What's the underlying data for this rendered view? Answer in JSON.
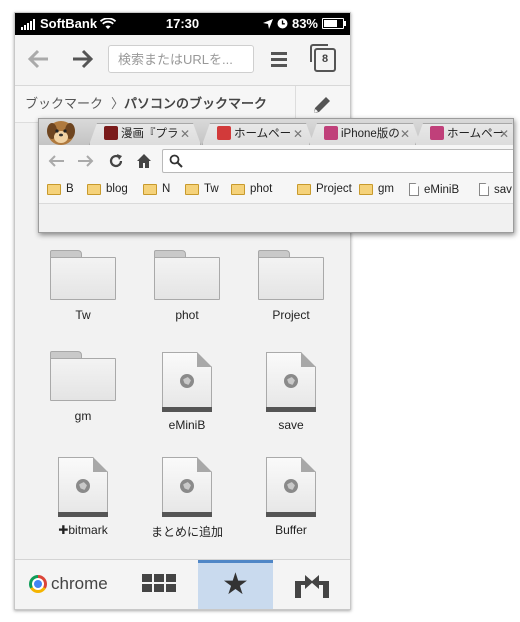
{
  "status_bar": {
    "carrier": "SoftBank",
    "time": "17:30",
    "battery": "83%",
    "battery_level": 0.83
  },
  "toolbar": {
    "omnibox_placeholder": "検索またはURLを...",
    "tab_count": "8"
  },
  "breadcrumb": {
    "root": "ブックマーク",
    "separator": "〉",
    "current": "パソコンのブックマーク"
  },
  "grid": {
    "items": [
      {
        "label": "Tw",
        "kind": "folder"
      },
      {
        "label": "phot",
        "kind": "folder"
      },
      {
        "label": "Project",
        "kind": "folder"
      },
      {
        "label": "gm",
        "kind": "folder"
      },
      {
        "label": "eMiniB",
        "kind": "page"
      },
      {
        "label": "save",
        "kind": "page"
      },
      {
        "label": "✚bitmark",
        "kind": "page"
      },
      {
        "label": "まとめに追加",
        "kind": "page"
      },
      {
        "label": "Buffer",
        "kind": "page"
      }
    ]
  },
  "bottom_bar": {
    "chrome_label": "chrome",
    "active_tab": "bookmarks",
    "accent": "#4f86c6",
    "active_bg": "#c9daee"
  },
  "desktop": {
    "tabs": [
      {
        "label": "漫画『プラ",
        "favicon_color": "#7a1a1a"
      },
      {
        "label": "ホームペー",
        "favicon_color": "#d23a3a"
      },
      {
        "label": "iPhone版の",
        "favicon_color": "#c0407a"
      },
      {
        "label": "ホームペー",
        "favicon_color": "#c0407a"
      }
    ],
    "bookmarks": [
      {
        "label": "B",
        "kind": "folder"
      },
      {
        "label": "blog",
        "kind": "folder"
      },
      {
        "label": "N",
        "kind": "folder"
      },
      {
        "label": "Tw",
        "kind": "folder"
      },
      {
        "label": "phot",
        "kind": "folder"
      },
      {
        "label": "Project",
        "kind": "folder"
      },
      {
        "label": "gm",
        "kind": "folder"
      },
      {
        "label": "eMiniB",
        "kind": "page"
      },
      {
        "label": "sav",
        "kind": "page"
      }
    ]
  }
}
